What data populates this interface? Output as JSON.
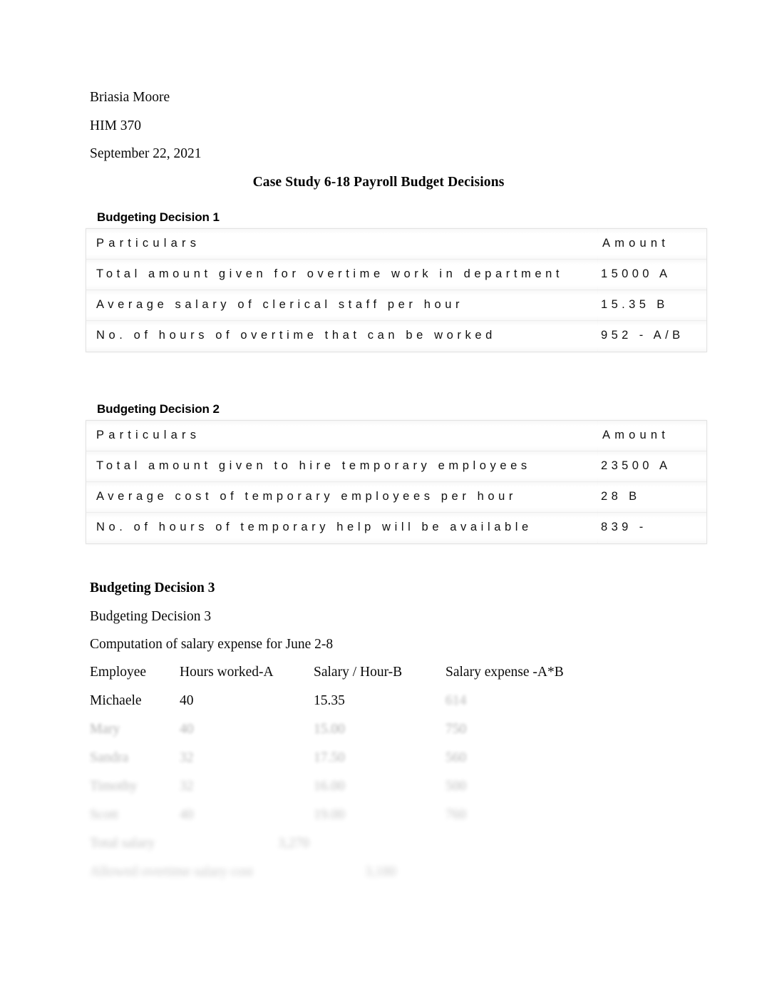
{
  "document": {
    "author": "Briasia Moore",
    "course": "HIM 370",
    "date": "September 22, 2021",
    "title": "Case Study 6-18 Payroll Budget Decisions"
  },
  "decision1": {
    "heading": "Budgeting Decision 1",
    "columns": {
      "particulars": "Particulars",
      "amount": "Amount"
    },
    "rows": [
      {
        "particulars": "Total amount given for overtime work in department",
        "amount": "15000 A"
      },
      {
        "particulars": "Average salary of clerical staff per hour",
        "amount": "15.35 B"
      },
      {
        "particulars": "No. of hours of overtime that can be worked",
        "amount": "952 - A/B"
      }
    ]
  },
  "decision2": {
    "heading": "Budgeting Decision 2",
    "columns": {
      "particulars": "Particulars",
      "amount": "Amount"
    },
    "rows": [
      {
        "particulars": "Total amount given to hire temporary employees",
        "amount": "23500 A"
      },
      {
        "particulars": "Average cost of temporary employees per hour",
        "amount": "28 B"
      },
      {
        "particulars": "No. of hours of temporary help will be available",
        "amount": "839 -"
      }
    ]
  },
  "decision3": {
    "heading": "Budgeting Decision 3",
    "subheading": "Budgeting Decision 3",
    "caption": "Computation of salary expense for June 2-8",
    "columns": {
      "employee": "Employee",
      "hours": "Hours worked-A",
      "rate": "Salary / Hour-B",
      "expense": "Salary expense -A*B"
    },
    "rows": [
      {
        "employee": "Michaele",
        "hours": "40",
        "rate": "15.35",
        "expense": "614"
      },
      {
        "employee": "Mary",
        "hours": "40",
        "rate": "15.00",
        "expense": "750"
      },
      {
        "employee": "Sandra",
        "hours": "32",
        "rate": "17.50",
        "expense": "560"
      },
      {
        "employee": "Timothy",
        "hours": "32",
        "rate": "16.00",
        "expense": "500"
      },
      {
        "employee": "Scott",
        "hours": "40",
        "rate": "19.00",
        "expense": "760"
      }
    ],
    "total_label": "Total salary",
    "total_value": "3,270",
    "overtime_label": "Allowed overtime salary cost",
    "overtime_value": "3,180"
  }
}
